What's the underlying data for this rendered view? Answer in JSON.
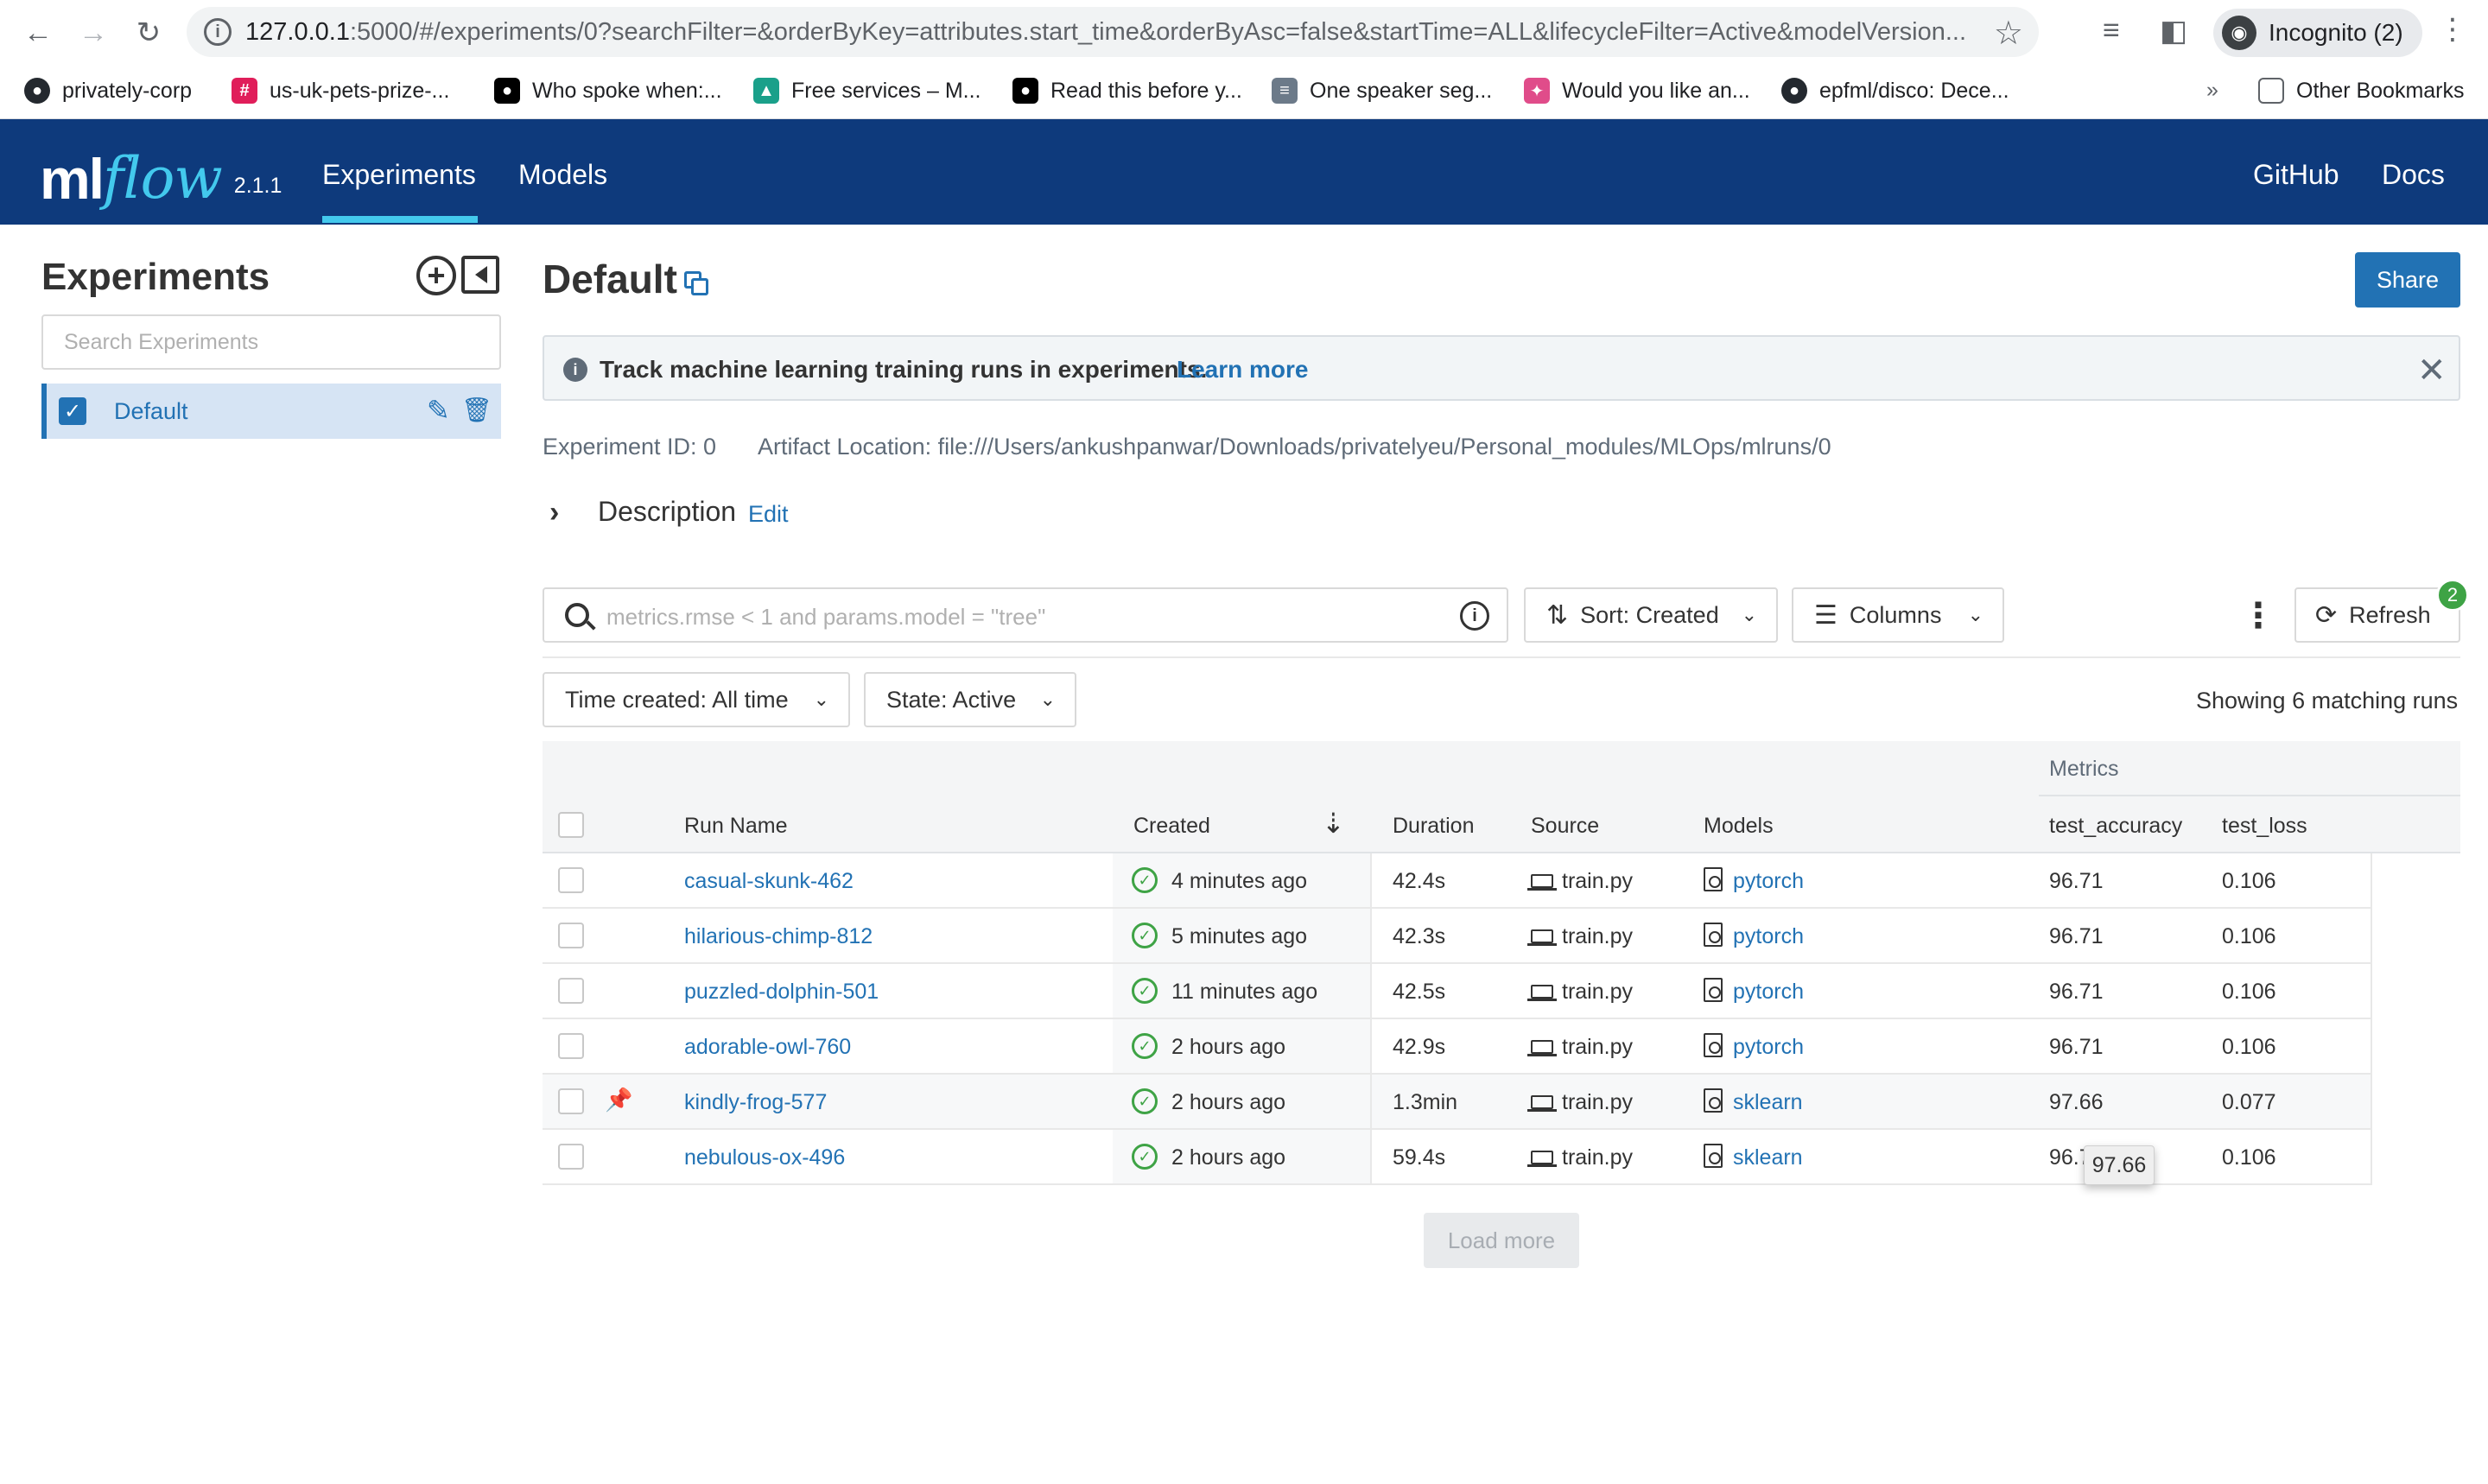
{
  "browser": {
    "url_host": "127.0.0.1",
    "url_rest": ":5000/#/experiments/0?searchFilter=&orderByKey=attributes.start_time&orderByAsc=false&startTime=ALL&lifecycleFilter=Active&modelVersion...",
    "incognito_label": "Incognito (2)",
    "bookmarks": [
      {
        "label": "privately-corp",
        "icon": "github-icon"
      },
      {
        "label": "us-uk-pets-prize-...",
        "icon": "slack-icon"
      },
      {
        "label": "Who spoke when:...",
        "icon": "medium-icon"
      },
      {
        "label": "Free services – M...",
        "icon": "bookmark-icon"
      },
      {
        "label": "Read this before y...",
        "icon": "medium-icon"
      },
      {
        "label": "One speaker seg...",
        "icon": "bookmark-icon"
      },
      {
        "label": "Would you like an...",
        "icon": "bookmark-icon"
      },
      {
        "label": "epfml/disco: Dece...",
        "icon": "github-icon"
      }
    ],
    "overflow": "»",
    "other_bookmarks": "Other Bookmarks"
  },
  "header": {
    "logo_ml": "ml",
    "logo_flow": "flow",
    "version": "2.1.1",
    "nav": [
      "Experiments",
      "Models"
    ],
    "right_nav": [
      "GitHub",
      "Docs"
    ]
  },
  "sidebar": {
    "title": "Experiments",
    "search_placeholder": "Search Experiments",
    "items": [
      {
        "label": "Default"
      }
    ]
  },
  "main": {
    "title": "Default",
    "share_label": "Share",
    "banner_text": "Track machine learning training runs in experiments.",
    "banner_link": "Learn more",
    "experiment_id": "Experiment ID: 0",
    "artifact_location": "Artifact Location: file:///Users/ankushpanwar/Downloads/privatelyeu/Personal_modules/MLOps/mlruns/0",
    "description_label": "Description",
    "description_edit": "Edit",
    "search_placeholder": "metrics.rmse < 1 and params.model = \"tree\"",
    "sort_label": "Sort: Created",
    "columns_label": "Columns",
    "refresh_label": "Refresh",
    "refresh_badge": "2",
    "time_filter": "Time created: All time",
    "state_filter": "State: Active",
    "match_count": "Showing 6 matching runs",
    "load_more": "Load more"
  },
  "table": {
    "metrics_group": "Metrics",
    "headers": {
      "run_name": "Run Name",
      "created": "Created",
      "duration": "Duration",
      "source": "Source",
      "models": "Models",
      "test_accuracy": "test_accuracy",
      "test_loss": "test_loss"
    },
    "rows": [
      {
        "name": "casual-skunk-462",
        "created": "4 minutes ago",
        "duration": "42.4s",
        "source": "train.py",
        "model": "pytorch",
        "acc": "96.71",
        "loss": "0.106"
      },
      {
        "name": "hilarious-chimp-812",
        "created": "5 minutes ago",
        "duration": "42.3s",
        "source": "train.py",
        "model": "pytorch",
        "acc": "96.71",
        "loss": "0.106"
      },
      {
        "name": "puzzled-dolphin-501",
        "created": "11 minutes ago",
        "duration": "42.5s",
        "source": "train.py",
        "model": "pytorch",
        "acc": "96.71",
        "loss": "0.106"
      },
      {
        "name": "adorable-owl-760",
        "created": "2 hours ago",
        "duration": "42.9s",
        "source": "train.py",
        "model": "pytorch",
        "acc": "96.71",
        "loss": "0.106"
      },
      {
        "name": "kindly-frog-577",
        "created": "2 hours ago",
        "duration": "1.3min",
        "source": "train.py",
        "model": "sklearn",
        "acc": "97.66",
        "loss": "0.077"
      },
      {
        "name": "nebulous-ox-496",
        "created": "2 hours ago",
        "duration": "59.4s",
        "source": "train.py",
        "model": "sklearn",
        "acc": "96.71",
        "loss": "0.106"
      }
    ],
    "tooltip": "97.66"
  },
  "colors": {
    "header_bg": "#0e3a7c",
    "accent": "#2272b4",
    "logo_flow": "#43c9ed",
    "success": "#3ea345"
  }
}
